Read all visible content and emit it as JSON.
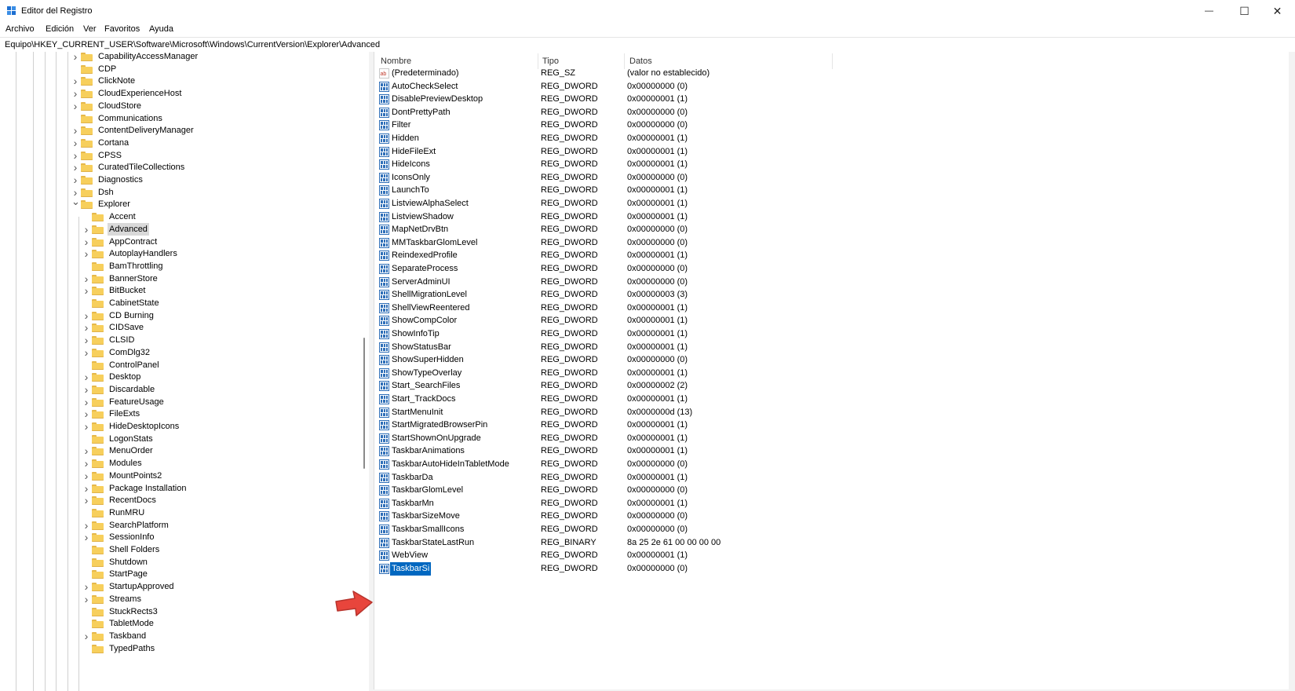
{
  "window": {
    "title": "Editor del Registro",
    "minimize": "—",
    "maximize": "☐",
    "close": "✕"
  },
  "menu": [
    "Archivo",
    "Edición",
    "Ver",
    "Favoritos",
    "Ayuda"
  ],
  "address": "Equipo\\HKEY_CURRENT_USER\\Software\\Microsoft\\Windows\\CurrentVersion\\Explorer\\Advanced",
  "columns": {
    "name": "Nombre",
    "type": "Tipo",
    "data": "Datos"
  },
  "tree": [
    {
      "label": "CapabilityAccessManager",
      "level": 0,
      "chevron": "right"
    },
    {
      "label": "CDP",
      "level": 0,
      "chevron": "none"
    },
    {
      "label": "ClickNote",
      "level": 0,
      "chevron": "right"
    },
    {
      "label": "CloudExperienceHost",
      "level": 0,
      "chevron": "right"
    },
    {
      "label": "CloudStore",
      "level": 0,
      "chevron": "right"
    },
    {
      "label": "Communications",
      "level": 0,
      "chevron": "none"
    },
    {
      "label": "ContentDeliveryManager",
      "level": 0,
      "chevron": "right"
    },
    {
      "label": "Cortana",
      "level": 0,
      "chevron": "right"
    },
    {
      "label": "CPSS",
      "level": 0,
      "chevron": "right"
    },
    {
      "label": "CuratedTileCollections",
      "level": 0,
      "chevron": "right"
    },
    {
      "label": "Diagnostics",
      "level": 0,
      "chevron": "right"
    },
    {
      "label": "Dsh",
      "level": 0,
      "chevron": "right"
    },
    {
      "label": "Explorer",
      "level": 0,
      "chevron": "down"
    },
    {
      "label": "Accent",
      "level": 1,
      "chevron": "none"
    },
    {
      "label": "Advanced",
      "level": 1,
      "chevron": "right",
      "selected": true
    },
    {
      "label": "AppContract",
      "level": 1,
      "chevron": "right"
    },
    {
      "label": "AutoplayHandlers",
      "level": 1,
      "chevron": "right"
    },
    {
      "label": "BamThrottling",
      "level": 1,
      "chevron": "none"
    },
    {
      "label": "BannerStore",
      "level": 1,
      "chevron": "right"
    },
    {
      "label": "BitBucket",
      "level": 1,
      "chevron": "right"
    },
    {
      "label": "CabinetState",
      "level": 1,
      "chevron": "none"
    },
    {
      "label": "CD Burning",
      "level": 1,
      "chevron": "right"
    },
    {
      "label": "CIDSave",
      "level": 1,
      "chevron": "right"
    },
    {
      "label": "CLSID",
      "level": 1,
      "chevron": "right"
    },
    {
      "label": "ComDlg32",
      "level": 1,
      "chevron": "right"
    },
    {
      "label": "ControlPanel",
      "level": 1,
      "chevron": "none"
    },
    {
      "label": "Desktop",
      "level": 1,
      "chevron": "right"
    },
    {
      "label": "Discardable",
      "level": 1,
      "chevron": "right"
    },
    {
      "label": "FeatureUsage",
      "level": 1,
      "chevron": "right"
    },
    {
      "label": "FileExts",
      "level": 1,
      "chevron": "right"
    },
    {
      "label": "HideDesktopIcons",
      "level": 1,
      "chevron": "right"
    },
    {
      "label": "LogonStats",
      "level": 1,
      "chevron": "none"
    },
    {
      "label": "MenuOrder",
      "level": 1,
      "chevron": "right"
    },
    {
      "label": "Modules",
      "level": 1,
      "chevron": "right"
    },
    {
      "label": "MountPoints2",
      "level": 1,
      "chevron": "right"
    },
    {
      "label": "Package Installation",
      "level": 1,
      "chevron": "right"
    },
    {
      "label": "RecentDocs",
      "level": 1,
      "chevron": "right"
    },
    {
      "label": "RunMRU",
      "level": 1,
      "chevron": "none"
    },
    {
      "label": "SearchPlatform",
      "level": 1,
      "chevron": "right"
    },
    {
      "label": "SessionInfo",
      "level": 1,
      "chevron": "right"
    },
    {
      "label": "Shell Folders",
      "level": 1,
      "chevron": "none"
    },
    {
      "label": "Shutdown",
      "level": 1,
      "chevron": "none"
    },
    {
      "label": "StartPage",
      "level": 1,
      "chevron": "none"
    },
    {
      "label": "StartupApproved",
      "level": 1,
      "chevron": "right"
    },
    {
      "label": "Streams",
      "level": 1,
      "chevron": "right"
    },
    {
      "label": "StuckRects3",
      "level": 1,
      "chevron": "none"
    },
    {
      "label": "TabletMode",
      "level": 1,
      "chevron": "none"
    },
    {
      "label": "Taskband",
      "level": 1,
      "chevron": "right"
    },
    {
      "label": "TypedPaths",
      "level": 1,
      "chevron": "none"
    }
  ],
  "values": [
    {
      "name": "(Predeterminado)",
      "type": "REG_SZ",
      "data": "(valor no establecido)",
      "icon": "string"
    },
    {
      "name": "AutoCheckSelect",
      "type": "REG_DWORD",
      "data": "0x00000000 (0)",
      "icon": "binary"
    },
    {
      "name": "DisablePreviewDesktop",
      "type": "REG_DWORD",
      "data": "0x00000001 (1)",
      "icon": "binary"
    },
    {
      "name": "DontPrettyPath",
      "type": "REG_DWORD",
      "data": "0x00000000 (0)",
      "icon": "binary"
    },
    {
      "name": "Filter",
      "type": "REG_DWORD",
      "data": "0x00000000 (0)",
      "icon": "binary"
    },
    {
      "name": "Hidden",
      "type": "REG_DWORD",
      "data": "0x00000001 (1)",
      "icon": "binary"
    },
    {
      "name": "HideFileExt",
      "type": "REG_DWORD",
      "data": "0x00000001 (1)",
      "icon": "binary"
    },
    {
      "name": "HideIcons",
      "type": "REG_DWORD",
      "data": "0x00000001 (1)",
      "icon": "binary"
    },
    {
      "name": "IconsOnly",
      "type": "REG_DWORD",
      "data": "0x00000000 (0)",
      "icon": "binary"
    },
    {
      "name": "LaunchTo",
      "type": "REG_DWORD",
      "data": "0x00000001 (1)",
      "icon": "binary"
    },
    {
      "name": "ListviewAlphaSelect",
      "type": "REG_DWORD",
      "data": "0x00000001 (1)",
      "icon": "binary"
    },
    {
      "name": "ListviewShadow",
      "type": "REG_DWORD",
      "data": "0x00000001 (1)",
      "icon": "binary"
    },
    {
      "name": "MapNetDrvBtn",
      "type": "REG_DWORD",
      "data": "0x00000000 (0)",
      "icon": "binary"
    },
    {
      "name": "MMTaskbarGlomLevel",
      "type": "REG_DWORD",
      "data": "0x00000000 (0)",
      "icon": "binary"
    },
    {
      "name": "ReindexedProfile",
      "type": "REG_DWORD",
      "data": "0x00000001 (1)",
      "icon": "binary"
    },
    {
      "name": "SeparateProcess",
      "type": "REG_DWORD",
      "data": "0x00000000 (0)",
      "icon": "binary"
    },
    {
      "name": "ServerAdminUI",
      "type": "REG_DWORD",
      "data": "0x00000000 (0)",
      "icon": "binary"
    },
    {
      "name": "ShellMigrationLevel",
      "type": "REG_DWORD",
      "data": "0x00000003 (3)",
      "icon": "binary"
    },
    {
      "name": "ShellViewReentered",
      "type": "REG_DWORD",
      "data": "0x00000001 (1)",
      "icon": "binary"
    },
    {
      "name": "ShowCompColor",
      "type": "REG_DWORD",
      "data": "0x00000001 (1)",
      "icon": "binary"
    },
    {
      "name": "ShowInfoTip",
      "type": "REG_DWORD",
      "data": "0x00000001 (1)",
      "icon": "binary"
    },
    {
      "name": "ShowStatusBar",
      "type": "REG_DWORD",
      "data": "0x00000001 (1)",
      "icon": "binary"
    },
    {
      "name": "ShowSuperHidden",
      "type": "REG_DWORD",
      "data": "0x00000000 (0)",
      "icon": "binary"
    },
    {
      "name": "ShowTypeOverlay",
      "type": "REG_DWORD",
      "data": "0x00000001 (1)",
      "icon": "binary"
    },
    {
      "name": "Start_SearchFiles",
      "type": "REG_DWORD",
      "data": "0x00000002 (2)",
      "icon": "binary"
    },
    {
      "name": "Start_TrackDocs",
      "type": "REG_DWORD",
      "data": "0x00000001 (1)",
      "icon": "binary"
    },
    {
      "name": "StartMenuInit",
      "type": "REG_DWORD",
      "data": "0x0000000d (13)",
      "icon": "binary"
    },
    {
      "name": "StartMigratedBrowserPin",
      "type": "REG_DWORD",
      "data": "0x00000001 (1)",
      "icon": "binary"
    },
    {
      "name": "StartShownOnUpgrade",
      "type": "REG_DWORD",
      "data": "0x00000001 (1)",
      "icon": "binary"
    },
    {
      "name": "TaskbarAnimations",
      "type": "REG_DWORD",
      "data": "0x00000001 (1)",
      "icon": "binary"
    },
    {
      "name": "TaskbarAutoHideInTabletMode",
      "type": "REG_DWORD",
      "data": "0x00000000 (0)",
      "icon": "binary"
    },
    {
      "name": "TaskbarDa",
      "type": "REG_DWORD",
      "data": "0x00000001 (1)",
      "icon": "binary"
    },
    {
      "name": "TaskbarGlomLevel",
      "type": "REG_DWORD",
      "data": "0x00000000 (0)",
      "icon": "binary"
    },
    {
      "name": "TaskbarMn",
      "type": "REG_DWORD",
      "data": "0x00000001 (1)",
      "icon": "binary"
    },
    {
      "name": "TaskbarSizeMove",
      "type": "REG_DWORD",
      "data": "0x00000000 (0)",
      "icon": "binary"
    },
    {
      "name": "TaskbarSmallIcons",
      "type": "REG_DWORD",
      "data": "0x00000000 (0)",
      "icon": "binary"
    },
    {
      "name": "TaskbarStateLastRun",
      "type": "REG_BINARY",
      "data": "8a 25 2e 61 00 00 00 00",
      "icon": "binary"
    },
    {
      "name": "WebView",
      "type": "REG_DWORD",
      "data": "0x00000001 (1)",
      "icon": "binary"
    },
    {
      "name": "TaskbarSi",
      "type": "REG_DWORD",
      "data": "0x00000000 (0)",
      "icon": "binary",
      "selected": true
    }
  ],
  "colors": {
    "selection": "#0067c0",
    "arrow": "#e8453c",
    "folder": "#f7cf5c"
  }
}
